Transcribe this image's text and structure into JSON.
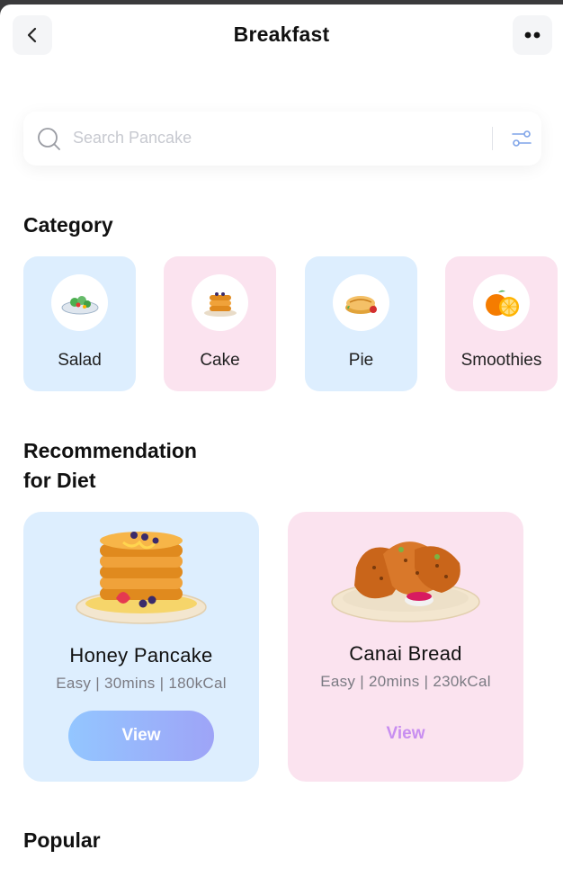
{
  "header": {
    "title": "Breakfast",
    "back_icon": "chevron-left-icon",
    "more_icon": "more-dots-icon"
  },
  "search": {
    "placeholder": "Search Pancake",
    "icon": "search-icon",
    "filter_icon": "filter-sliders-icon"
  },
  "category": {
    "title": "Category",
    "items": [
      {
        "label": "Salad",
        "icon": "salad-icon",
        "color": "#ddeefe"
      },
      {
        "label": "Cake",
        "icon": "pancake-stack-icon",
        "color": "#fbe3ef"
      },
      {
        "label": "Pie",
        "icon": "pie-icon",
        "color": "#ddeefe"
      },
      {
        "label": "Smoothies",
        "icon": "orange-icon",
        "color": "#fbe3ef"
      }
    ]
  },
  "recommendation": {
    "title_line1": "Recommendation",
    "title_line2": "for Diet",
    "cards": [
      {
        "name": "Honey Pancake",
        "meta": "Easy | 30mins | 180kCal",
        "action": "View",
        "color": "#ddeefe"
      },
      {
        "name": "Canai Bread",
        "meta": "Easy | 20mins | 230kCal",
        "action": "View",
        "color": "#fbe3ef"
      }
    ]
  },
  "popular": {
    "title": "Popular"
  },
  "colors": {
    "accent_gradient_start": "#93c6ff",
    "accent_gradient_end": "#9ea4f7",
    "link_purple": "#c88ef0"
  }
}
